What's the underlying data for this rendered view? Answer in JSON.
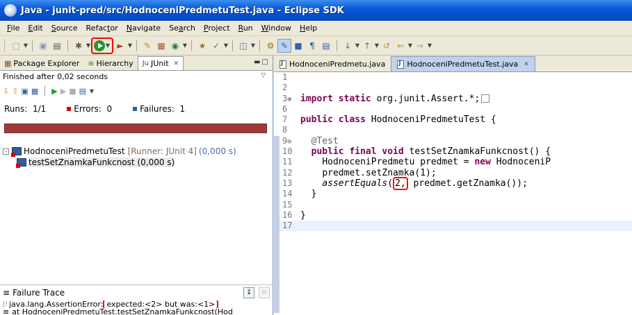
{
  "window": {
    "title": "Java - junit-pred/src/HodnoceniPredmetuTest.java - Eclipse SDK"
  },
  "menubar": {
    "items": [
      {
        "label": "File",
        "mnemonic": "F",
        "rest": "ile"
      },
      {
        "label": "Edit",
        "mnemonic": "E",
        "rest": "dit"
      },
      {
        "label": "Source",
        "mnemonic": "S",
        "rest": "ource"
      },
      {
        "label": "Refactor",
        "pre": "Refac",
        "mnemonic": "t",
        "rest": "or"
      },
      {
        "label": "Navigate",
        "mnemonic": "N",
        "rest": "avigate"
      },
      {
        "label": "Search",
        "pre": "Se",
        "mnemonic": "a",
        "rest": "rch"
      },
      {
        "label": "Project",
        "mnemonic": "P",
        "rest": "roject"
      },
      {
        "label": "Run",
        "mnemonic": "R",
        "rest": "un"
      },
      {
        "label": "Window",
        "mnemonic": "W",
        "rest": "indow"
      },
      {
        "label": "Help",
        "mnemonic": "H",
        "rest": "elp"
      }
    ]
  },
  "left_view": {
    "tabs": [
      {
        "label": "Package Explorer",
        "icon": "package-explorer-icon"
      },
      {
        "label": "Hierarchy",
        "icon": "hierarchy-icon"
      },
      {
        "label": "JUnit",
        "icon": "junit-icon",
        "active": true
      }
    ],
    "status": "Finished after 0,02 seconds",
    "runs_label": "Runs:",
    "runs_value": "1/1",
    "errors_label": "Errors:",
    "errors_value": "0",
    "failures_label": "Failures:",
    "failures_value": "1",
    "progress_fraction": 1.0,
    "progress_color": "#9c3a3a",
    "tree": {
      "suite_name": "HodnoceniPredmetuTest",
      "runner": "[Runner: JUnit 4]",
      "suite_time": "(0,000 s)",
      "test_name": "testSetZnamkaFunkcnost",
      "test_time": "(0,000 s)"
    },
    "failure_trace": {
      "title": "Failure Trace",
      "line1_prefix": "java.lang.AssertionError:",
      "line1_message": "expected:<2> but was:<1>",
      "line2": "at HodnoceniPredmetuTest.testSetZnamkaFunkcnost(Hod"
    }
  },
  "editor": {
    "tabs": [
      {
        "label": "HodnoceniPredmetu.java",
        "active": false
      },
      {
        "label": "HodnoceniPredmetuTest.java",
        "active": true
      }
    ],
    "lines": {
      "n1": "1",
      "n2": "2",
      "n3": "3",
      "import_kw": "import static",
      "import_rest": " org.junit.Assert.*;",
      "n6": "6",
      "n7": "7",
      "class_kw": "public class",
      "class_rest": " HodnoceniPredmetuTest {",
      "n8": "8",
      "n9": "9",
      "annotation": "@Test",
      "n10": "10",
      "method_kw": "public final void",
      "method_rest": " testSetZnamkaFunkcnost() {",
      "n11": "11",
      "l11_pre": "HodnoceniPredmetu predmet = ",
      "l11_kw": "new",
      "l11_post": " HodnoceniP",
      "n12": "12",
      "l12": "predmet.setZnamka(1);",
      "n13": "13",
      "l13_call": "assertEquals",
      "l13_open": "(",
      "l13_arg": "2,",
      "l13_rest": " predmet.getZnamka());",
      "n14": "14",
      "l14": "}",
      "n15": "15",
      "n16": "16",
      "l16": "}",
      "n17": "17"
    }
  }
}
